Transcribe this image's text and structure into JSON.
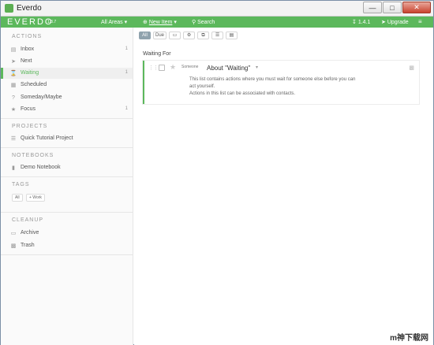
{
  "window": {
    "title": "Everdo"
  },
  "appbar": {
    "logo": "EVERDO",
    "logo_version": "1.3.7",
    "areas": "All Areas",
    "new_item": "New Item",
    "search": "Search",
    "version": "1.4.1",
    "upgrade": "Upgrade"
  },
  "sidebar": {
    "actions_title": "ACTIONS",
    "actions": [
      {
        "label": "Inbox",
        "count": "1",
        "icon": "inbox-icon"
      },
      {
        "label": "Next",
        "count": "",
        "icon": "next-icon"
      },
      {
        "label": "Waiting",
        "count": "1",
        "icon": "waiting-icon"
      },
      {
        "label": "Scheduled",
        "count": "",
        "icon": "calendar-icon"
      },
      {
        "label": "Someday/Maybe",
        "count": "",
        "icon": "question-icon"
      },
      {
        "label": "Focus",
        "count": "1",
        "icon": "star-icon"
      }
    ],
    "projects_title": "PROJECTS",
    "projects": [
      {
        "label": "Quick Tutorial Project"
      }
    ],
    "notebooks_title": "NOTEBOOKS",
    "notebooks": [
      {
        "label": "Demo Notebook"
      }
    ],
    "tags_title": "TAGS",
    "tags": [
      "All",
      "+ Work"
    ],
    "cleanup_title": "CLEANUP",
    "cleanup": [
      {
        "label": "Archive"
      },
      {
        "label": "Trash"
      }
    ]
  },
  "toolbar": {
    "all": "All",
    "due": "Due"
  },
  "main": {
    "list_title": "Waiting For",
    "item": {
      "context": "Someone",
      "title": "About \"Waiting\"",
      "description_lines": [
        "This list contains actions where you must wait for someone else before you can",
        "act yourself.",
        "Actions in this list can be associated with contacts."
      ]
    }
  },
  "watermark": "m神下载网",
  "colors": {
    "accent": "#5cb85c",
    "filter_active": "#8fa2ad"
  }
}
